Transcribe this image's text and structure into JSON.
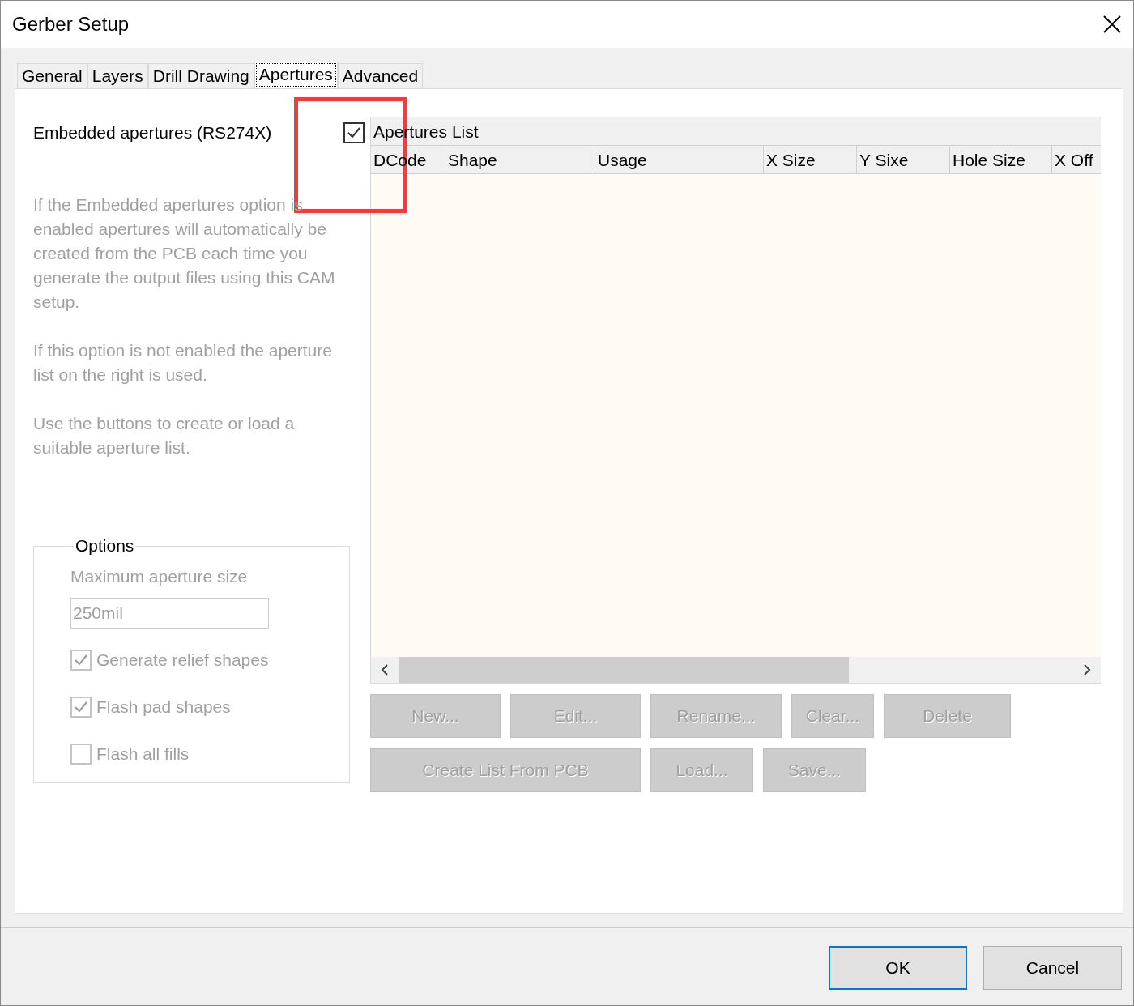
{
  "window": {
    "title": "Gerber Setup"
  },
  "tabs": [
    {
      "label": "General",
      "selected": false
    },
    {
      "label": "Layers",
      "selected": false
    },
    {
      "label": "Drill Drawing",
      "selected": false
    },
    {
      "label": "Apertures",
      "selected": true
    },
    {
      "label": "Advanced",
      "selected": false
    }
  ],
  "embedded": {
    "label": "Embedded apertures (RS274X)",
    "checked": true
  },
  "help_paragraphs": [
    "If the Embedded apertures option is enabled apertures will automatically be created from the PCB each time you generate the output files using this CAM setup.",
    "If this option is not enabled the aperture list on the right is used.",
    "Use the buttons to create or load a suitable aperture list."
  ],
  "options": {
    "title": "Options",
    "max_size_label": "Maximum aperture size",
    "max_size_value": "250mil",
    "disabled": true,
    "checkboxes": [
      {
        "label": "Generate relief shapes",
        "checked": true,
        "disabled": true
      },
      {
        "label": "Flash pad shapes",
        "checked": true,
        "disabled": true
      },
      {
        "label": "Flash all fills",
        "checked": false,
        "disabled": true
      }
    ]
  },
  "aperture_list": {
    "title": "Apertures List",
    "columns": [
      "DCode",
      "Shape",
      "Usage",
      "X Size",
      "Y Sixe",
      "Hole Size",
      "X Off"
    ]
  },
  "button_rows": [
    {
      "buttons": [
        {
          "label": "New...",
          "disabled": true
        },
        {
          "label": "Edit...",
          "disabled": true
        },
        {
          "label": "Rename...",
          "disabled": true
        },
        {
          "label": "Clear...",
          "disabled": true
        },
        {
          "label": "Delete",
          "disabled": true
        }
      ]
    },
    {
      "buttons": [
        {
          "label": "Create List From PCB",
          "disabled": true
        },
        {
          "label": "Load...",
          "disabled": true
        },
        {
          "label": "Save...",
          "disabled": true
        }
      ]
    }
  ],
  "dialog_buttons": [
    {
      "label": "OK",
      "default": true
    },
    {
      "label": "Cancel",
      "default": false
    }
  ],
  "annotations": [
    {
      "kind": "rectangle"
    }
  ]
}
